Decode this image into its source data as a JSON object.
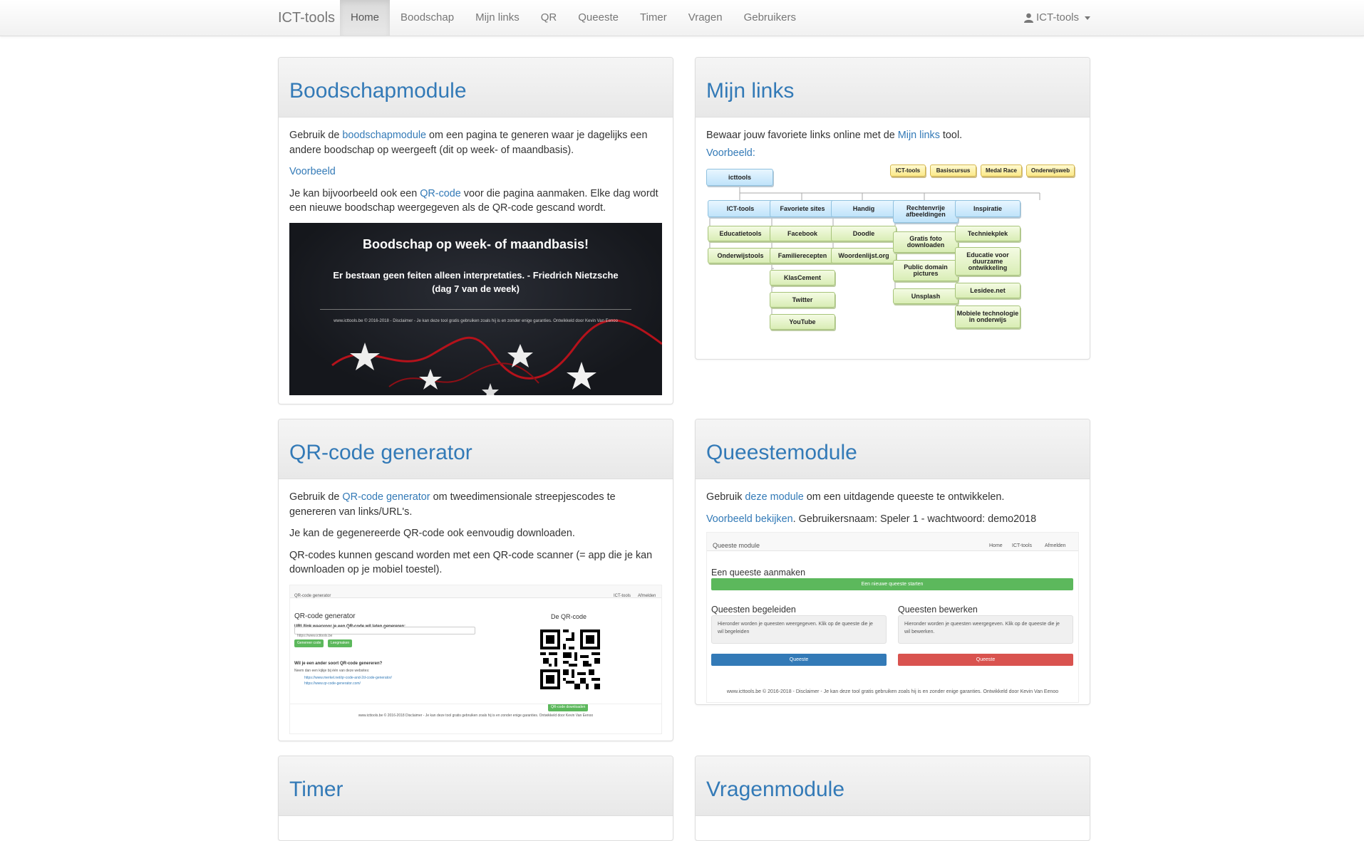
{
  "nav": {
    "brand": "ICT-tools",
    "items": [
      "Home",
      "Boodschap",
      "Mijn links",
      "QR",
      "Queeste",
      "Timer",
      "Vragen",
      "Gebruikers"
    ],
    "user": "ICT-tools"
  },
  "boodschap": {
    "title": "Boodschapmodule",
    "p1_pre": "Gebruik de ",
    "p1_link": "boodschapmodule",
    "p1_post": " om een pagina te generen waar je dagelijks een andere boodschap op weergeeft (dit op week- of maandbasis).",
    "example": "Voorbeeld",
    "p2_pre": "Je kan bijvoorbeeld ook een ",
    "p2_link": "QR-code",
    "p2_post": " voor die pagina aanmaken. Elke dag wordt een nieuwe boodschap weergegeven als de QR-code gescand wordt.",
    "img_title": "Boodschap op week- of maandbasis!",
    "img_quote": "Er bestaan geen feiten alleen interpretaties. - Friedrich Nietzsche",
    "img_day": "(dag 7 van de week)",
    "img_footer": "www.icttools.be © 2016-2018 - Disclaimer - Je kan deze tool gratis gebruiken zoals hij is en zonder enige garanties. Ontwikkeld door Kevin Van Eenoo"
  },
  "links": {
    "title": "Mijn links",
    "p1_pre": "Bewaar jouw favoriete links online met de ",
    "p1_link": "Mijn links",
    "p1_post": " tool.",
    "example": "Voorbeeld:",
    "root": "icttools",
    "tags": [
      "ICT-tools",
      "Basiscursus",
      "Medal Race",
      "Onderwijsweb"
    ],
    "categories": [
      "ICT-tools",
      "Favoriete sites",
      "Handig",
      "Rechtenvrije afbeeldingen",
      "Inspiratie"
    ],
    "col1": [
      "Educatietools",
      "Onderwijstools"
    ],
    "col2": [
      "Facebook",
      "Familierecepten",
      "KlasCement",
      "Twitter",
      "YouTube"
    ],
    "col3": [
      "Doodle",
      "Woordenlijst.org"
    ],
    "col4": [
      "Gratis foto downloaden",
      "Public domain pictures",
      "Unsplash"
    ],
    "col5": [
      "Techniekplek",
      "Educatie voor duurzame ontwikkeling",
      "Lesidee.net",
      "Mobiele technologie in onderwijs"
    ]
  },
  "qr": {
    "title": "QR-code generator",
    "p1_pre": "Gebruik de ",
    "p1_link": "QR-code generator",
    "p1_post": " om tweedimensionale streepjescodes te genereren van links/URL's.",
    "p2": "Je kan de gegenereerde QR-code ook eenvoudig downloaden.",
    "p3": "QR-codes kunnen gescand worden met een QR-code scanner (= app die je kan downloaden op je mobiel toestel).",
    "mock": {
      "bar_title": "QR-code generator",
      "bar_nav1": "ICT-tools",
      "bar_nav2": "Afmelden",
      "heading": "QR-code generator",
      "label": "URL/link waarvoor je een QR-code wil laten genereren:",
      "input_value": "https://www.icttools.be",
      "btn_generate": "Genereer code",
      "btn_clear": "Leegmaken",
      "question": "Wil je een ander soort QR-code genereren?",
      "sub": "Neem dan een kijkje bij één van deze websites:",
      "site1": "https://www.merkel.net/qr-code-and-2d-code-generator/",
      "site2": "https://www.qr-code-generator.com/",
      "qr_heading": "De QR-code",
      "btn_download": "QR-code downloaden",
      "footer": "www.icttools.be © 2016-2018 Disclaimer - Je kan deze tool gratis gebruiken zoals hij is en zonder enige garanties. Ontwikkeld door Kevin Van Eenoo"
    }
  },
  "queeste": {
    "title": "Queestemodule",
    "p1_pre": "Gebruik ",
    "p1_link": "deze module",
    "p1_post": " om een uitdagende queeste te ontwikkelen.",
    "p2_link": "Voorbeeld bekijken",
    "p2_post": ". Gebruikersnaam: Speler 1 - wachtwoord: demo2018",
    "mock": {
      "bar_title": "Queeste module",
      "nav1": "Home",
      "nav2": "ICT-tools",
      "nav3": "Afmelden",
      "create": "Een queeste aanmaken",
      "btn_start": "Een nieuwe queeste starten",
      "guide": "Queesten begeleiden",
      "edit": "Queesten bewerken",
      "guide_text": "Hieronder worden je queesten weergegeven. Klik op de queeste die je wil begeleiden",
      "edit_text": "Hieronder worden je queesten weergegeven. Klik op de queeste die je wil bewerken.",
      "btn_queeste1": "Queeste",
      "btn_queeste2": "Queeste",
      "footer": "www.icttools.be © 2016-2018 - Disclaimer - Je kan deze tool gratis gebruiken zoals hij is en zonder enige garanties. Ontwikkeld door Kevin Van Eenoo"
    }
  },
  "timer": {
    "title": "Timer"
  },
  "vragen": {
    "title": "Vragenmodule"
  },
  "colors": {
    "link": "#337ab7",
    "green": "#5cb85c",
    "blue": "#337ab7",
    "red": "#d9534f"
  }
}
